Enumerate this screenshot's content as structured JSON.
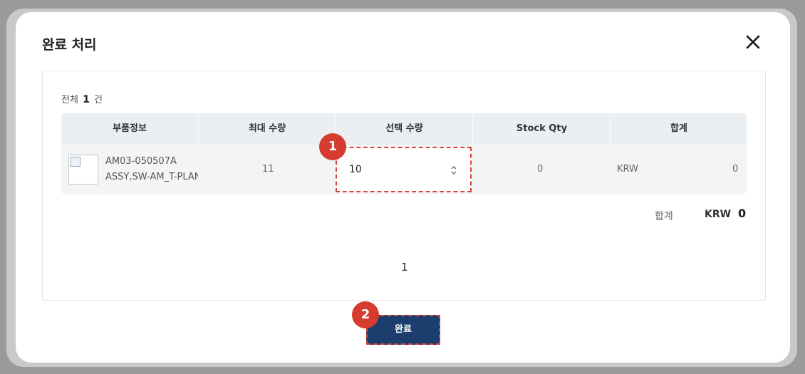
{
  "modal": {
    "title": "완료 처리"
  },
  "summary": {
    "total_prefix": "전체",
    "total_count": "1",
    "total_suffix": "건"
  },
  "table": {
    "headers": [
      "부품정보",
      "최대 수량",
      "선택 수량",
      "Stock Qty",
      "합계"
    ],
    "rows": [
      {
        "part_code": "AM03-050507A",
        "part_name": "ASSY,SW-AM_T-PLAN",
        "max_qty": "11",
        "selected_qty": "10",
        "stock_qty": "0",
        "currency": "KRW",
        "amount": "0"
      }
    ]
  },
  "footer_total": {
    "label": "합계",
    "currency": "KRW",
    "amount": "0"
  },
  "pagination": {
    "current_page": "1"
  },
  "annotations": {
    "step1": "1",
    "step2": "2"
  },
  "actions": {
    "complete_label": "완료"
  },
  "colors": {
    "primary_button": "#1b3e6e",
    "annotation_red": "#d63b2f",
    "table_header_bg": "#eceff2"
  }
}
